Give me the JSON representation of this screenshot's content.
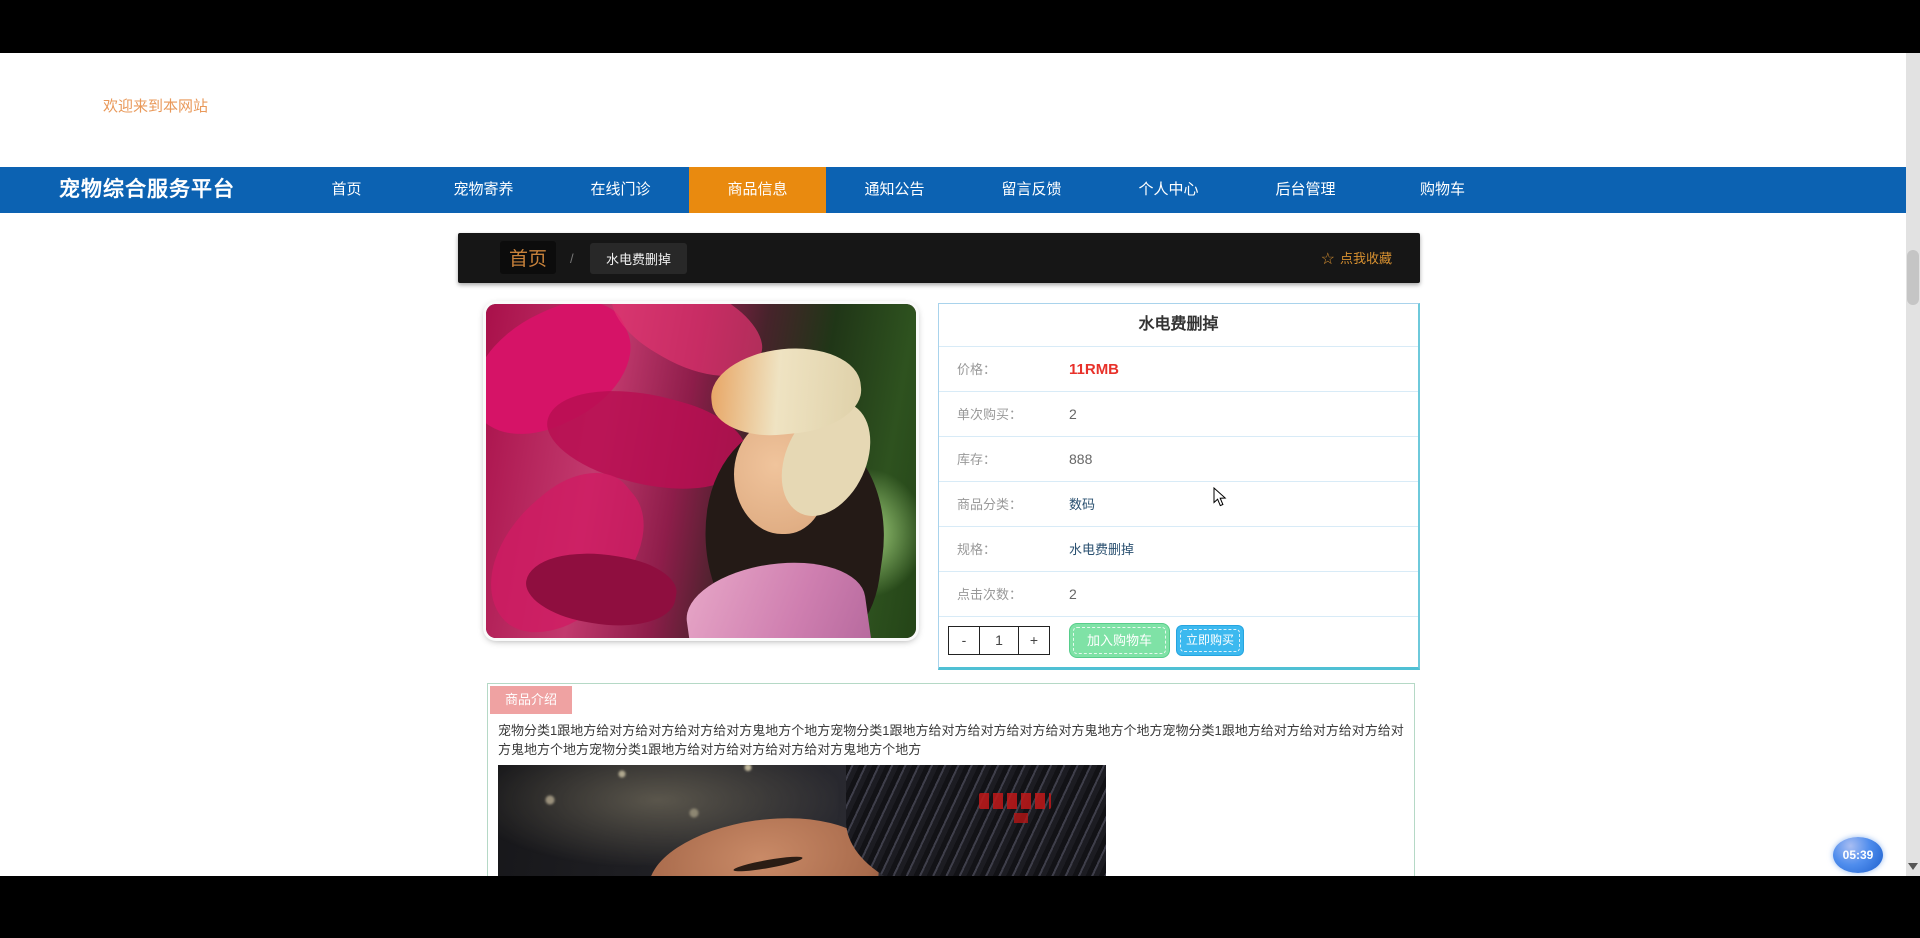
{
  "header": {
    "welcome": "欢迎来到本网站"
  },
  "nav": {
    "brand": "宠物综合服务平台",
    "items": [
      {
        "label": "首页",
        "active": false
      },
      {
        "label": "宠物寄养",
        "active": false
      },
      {
        "label": "在线门诊",
        "active": false
      },
      {
        "label": "商品信息",
        "active": true
      },
      {
        "label": "通知公告",
        "active": false
      },
      {
        "label": "留言反馈",
        "active": false
      },
      {
        "label": "个人中心",
        "active": false
      },
      {
        "label": "后台管理",
        "active": false
      },
      {
        "label": "购物车",
        "active": false
      }
    ]
  },
  "breadcrumb": {
    "home": "首页",
    "separator": "/",
    "current": "水电费删掉",
    "star_icon": "☆",
    "favorite_label": "点我收藏"
  },
  "product": {
    "title": "水电费删掉",
    "rows": [
      {
        "label": "价格：",
        "value": "11RMB"
      },
      {
        "label": "单次购买：",
        "value": "2"
      },
      {
        "label": "库存：",
        "value": "888"
      },
      {
        "label": "商品分类：",
        "value": "数码"
      },
      {
        "label": "规格：",
        "value": "水电费删掉"
      },
      {
        "label": "点击次数：",
        "value": "2"
      }
    ],
    "qty": {
      "minus": "-",
      "value": "1",
      "plus": "+"
    },
    "add_to_cart_label": "加入购物车",
    "buy_now_label": "立即购买"
  },
  "intro": {
    "tab_label": "商品介绍",
    "description": "宠物分类1跟地方给对方给对方给对方给对方鬼地方个地方宠物分类1跟地方给对方给对方给对方给对方鬼地方个地方宠物分类1跟地方给对方给对方给对方给对方鬼地方个地方宠物分类1跟地方给对方给对方给对方给对方鬼地方个地方"
  },
  "timer": {
    "value": "05:39"
  },
  "colors": {
    "nav_blue": "#0c62b2",
    "active_orange": "#e98a0f",
    "price_red": "#e8312a",
    "cart_green": "#7fe2a6",
    "buy_blue": "#3cb9ef",
    "tab_pink": "#efa2a2",
    "panel_border": "#a9d3ec",
    "panel_accent": "#4fc0d4"
  }
}
